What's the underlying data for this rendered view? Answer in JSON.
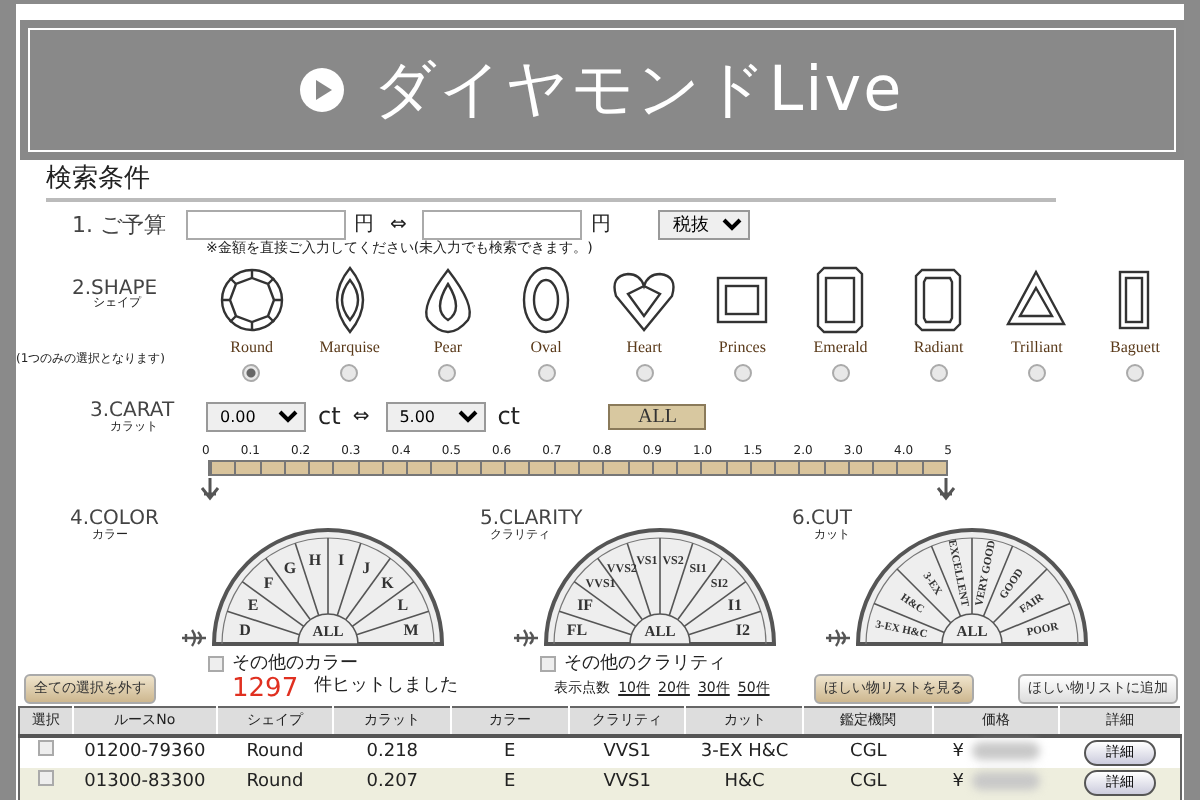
{
  "banner": {
    "title": "ダイヤモンドLive"
  },
  "section_title": "検索条件",
  "budget": {
    "label": "1. ご予算",
    "min_unit": "円",
    "separator": "⇔",
    "max_unit": "円",
    "tax_select": "税抜",
    "note": "※金額を直接ご入力してください(未入力でも検索できます。)"
  },
  "shape": {
    "label": "2.SHAPE",
    "label_sub": "シェイプ",
    "hint": "(1つのみの選択となります)",
    "options": [
      {
        "name": "Round",
        "kind": "round",
        "selected": true
      },
      {
        "name": "Marquise",
        "kind": "marquise",
        "selected": false
      },
      {
        "name": "Pear",
        "kind": "pear",
        "selected": false
      },
      {
        "name": "Oval",
        "kind": "oval",
        "selected": false
      },
      {
        "name": "Heart",
        "kind": "heart",
        "selected": false
      },
      {
        "name": "Princes",
        "kind": "princess",
        "selected": false
      },
      {
        "name": "Emerald",
        "kind": "emerald",
        "selected": false
      },
      {
        "name": "Radiant",
        "kind": "radiant",
        "selected": false
      },
      {
        "name": "Trilliant",
        "kind": "trilliant",
        "selected": false
      },
      {
        "name": "Baguett",
        "kind": "baguette",
        "selected": false
      }
    ]
  },
  "carat": {
    "label": "3.CARAT",
    "label_sub": "カラット",
    "min": "0.00",
    "min_unit": "ct",
    "separator": "⇔",
    "max": "5.00",
    "max_unit": "ct",
    "all_button": "ALL",
    "scale": [
      "0",
      "0.1",
      "0.2",
      "0.3",
      "0.4",
      "0.5",
      "0.6",
      "0.7",
      "0.8",
      "0.9",
      "1.0",
      "1.5",
      "2.0",
      "3.0",
      "4.0",
      "5"
    ],
    "handles": [
      {
        "level": 0
      },
      {
        "level": 1
      }
    ]
  },
  "color": {
    "label": "4.COLOR",
    "label_sub": "カラー",
    "grades": [
      "D",
      "E",
      "F",
      "G",
      "H",
      "I",
      "J",
      "K",
      "L",
      "M"
    ],
    "all": "ALL",
    "other": {
      "label": "その他のカラー",
      "checked": false
    }
  },
  "clarity": {
    "label": "5.CLARITY",
    "label_sub": "クラリティ",
    "grades": [
      "FL",
      "IF",
      "VVS1",
      "VVS2",
      "VS1",
      "VS2",
      "SI1",
      "SI2",
      "I1",
      "I2"
    ],
    "all": "ALL",
    "other": {
      "label": "その他のクラリティ",
      "checked": false
    }
  },
  "cut": {
    "label": "6.CUT",
    "label_sub": "カット",
    "grades": [
      "3-EX H&C",
      "H&C",
      "3-EX",
      "EXCELLENT",
      "VERY GOOD",
      "GOOD",
      "FAIR",
      "POOR"
    ],
    "all": "ALL"
  },
  "clear_button": "全ての選択を外す",
  "hits": {
    "count": "1297",
    "text": "件ヒットしました"
  },
  "per_page": {
    "label": "表示点数",
    "options": [
      "10件",
      "20件",
      "30件",
      "50件"
    ]
  },
  "wishlist_view": "ほしい物リストを見る",
  "wishlist_add": "ほしい物リストに追加",
  "table": {
    "columns": [
      "選択",
      "ルースNo",
      "シェイプ",
      "カラット",
      "カラー",
      "クラリティ",
      "カット",
      "鑑定機関",
      "価格",
      "詳細"
    ],
    "rows": [
      {
        "checked": false,
        "cells": [
          "",
          "01200-79360",
          "Round",
          "0.218",
          "E",
          "VVS1",
          "3-EX H&C",
          "CGL",
          "¥",
          "詳細"
        ]
      },
      {
        "checked": false,
        "cells": [
          "",
          "01300-83300",
          "Round",
          "0.207",
          "E",
          "VVS1",
          "H&C",
          "CGL",
          "¥",
          "詳細"
        ]
      }
    ]
  }
}
